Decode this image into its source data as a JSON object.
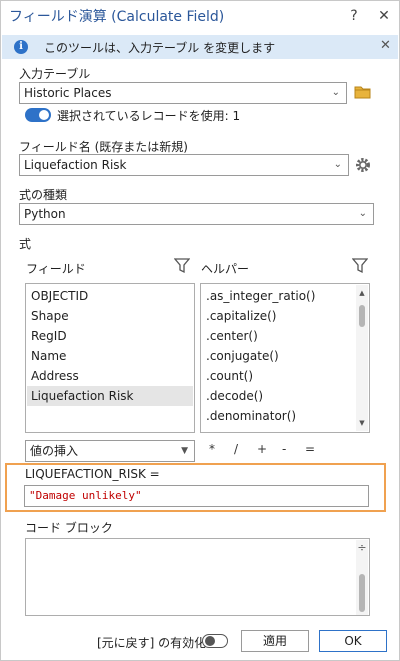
{
  "window": {
    "title": "フィールド演算 (Calculate Field)",
    "help": "?",
    "close": "✕"
  },
  "info_bar": {
    "text": "このツールは、入力テーブル を変更します",
    "close": "✕"
  },
  "input_table": {
    "label": "入力テーブル",
    "value": "Historic Places",
    "use_selected_label": "選択されているレコードを使用: 1",
    "use_selected_on": true
  },
  "field_name": {
    "label": "フィールド名 (既存または新規)",
    "value": "Liquefaction Risk"
  },
  "expression_type": {
    "label": "式の種類",
    "value": "Python"
  },
  "expression": {
    "label": "式",
    "fields_header": "フィールド",
    "helpers_header": "ヘルパー",
    "fields": [
      "OBJECTID",
      "Shape",
      "RegID",
      "Name",
      "Address",
      "Liquefaction Risk"
    ],
    "selected_field": "Liquefaction Risk",
    "helpers": [
      ".as_integer_ratio()",
      ".capitalize()",
      ".center()",
      ".conjugate()",
      ".count()",
      ".decode()",
      ".denominator()"
    ],
    "insert_values_label": "値の挿入",
    "operators": [
      "*",
      "/",
      "+",
      "-",
      "="
    ],
    "target_label": "LIQUEFACTION_RISK =",
    "value": "\"Damage unlikely\""
  },
  "code_block": {
    "label": "コード ブロック",
    "value": ""
  },
  "footer": {
    "undo_label": "[元に戻す] の有効化",
    "undo_on": false,
    "apply_label": "適用",
    "ok_label": "OK"
  },
  "colors": {
    "accent": "#2e72c8",
    "title_text": "#2b579a",
    "info_bg": "#dbe9f7",
    "highlight_frame": "#f0a150",
    "expression_text": "#c00000",
    "folder_icon": "#e8b33c"
  }
}
